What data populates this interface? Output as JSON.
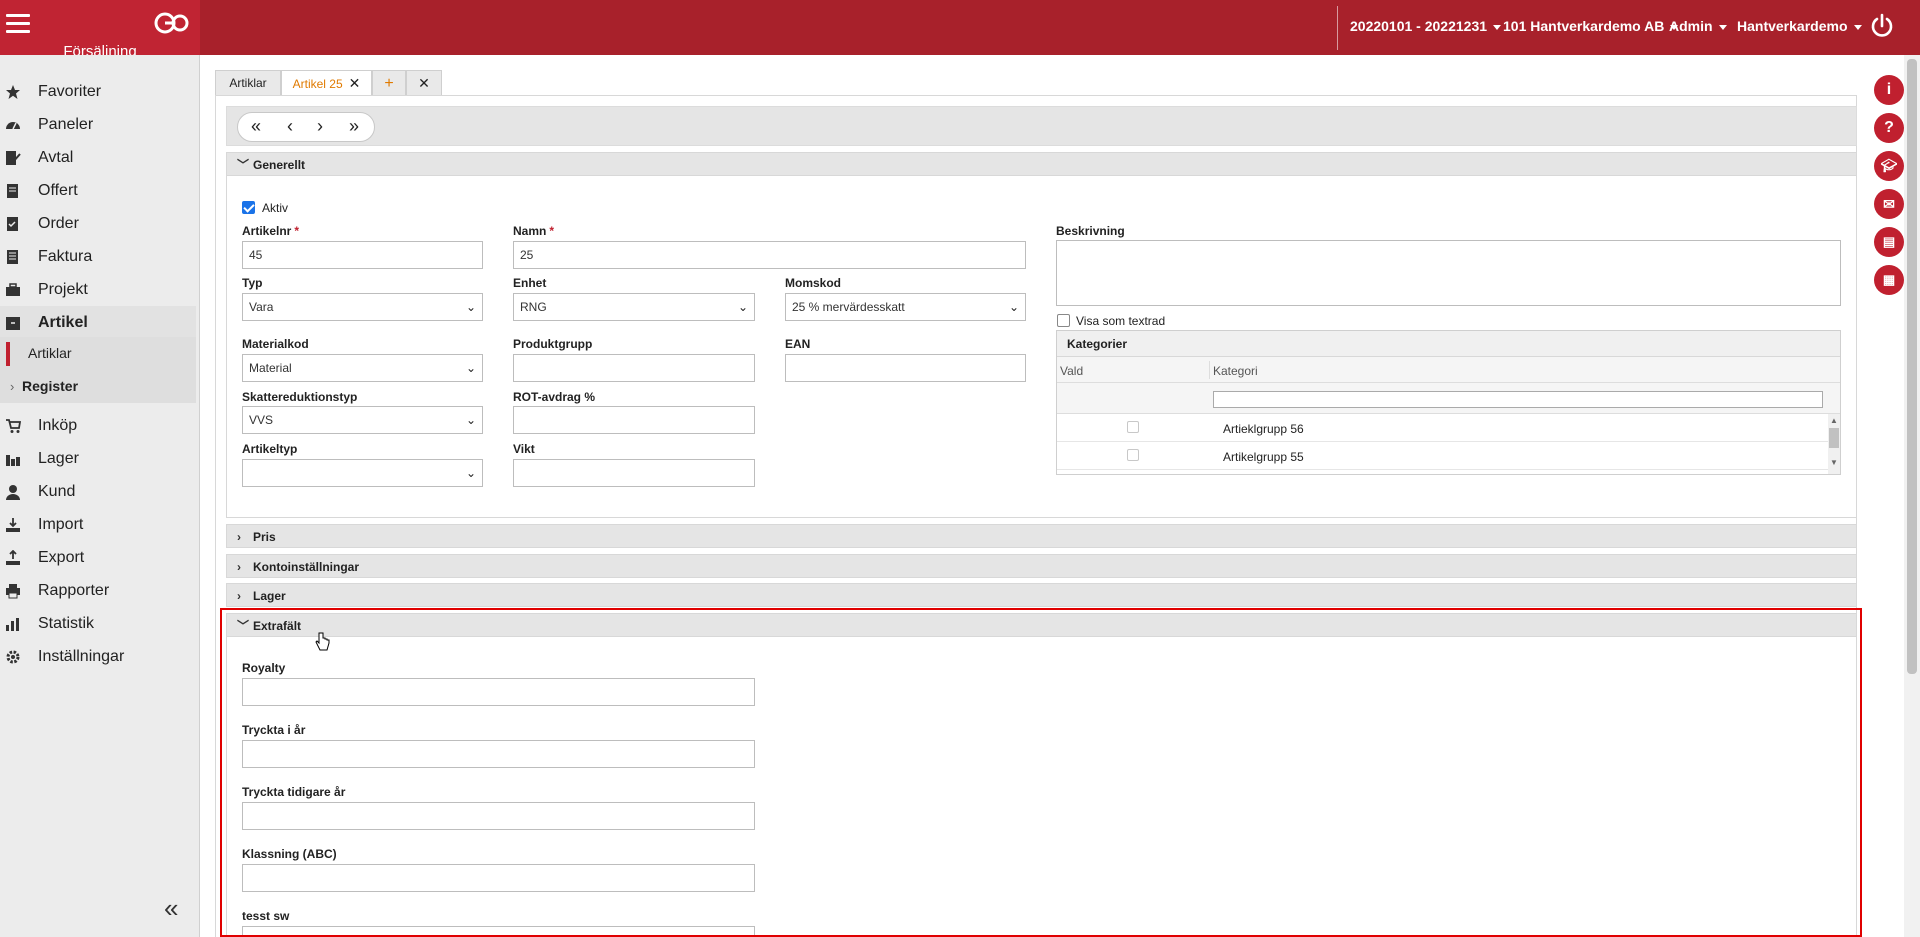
{
  "header": {
    "module_title": "Försäljning",
    "period": "20220101 - 20221231",
    "company": "101 Hantverkardemo AB",
    "role": "Admin",
    "user": "Hantverkardemo"
  },
  "sidebar": {
    "items": [
      {
        "label": "Favoriter",
        "icon": "star-icon"
      },
      {
        "label": "Paneler",
        "icon": "dashboard-icon"
      },
      {
        "label": "Avtal",
        "icon": "contract-icon"
      },
      {
        "label": "Offert",
        "icon": "document-icon"
      },
      {
        "label": "Order",
        "icon": "order-icon"
      },
      {
        "label": "Faktura",
        "icon": "invoice-icon"
      },
      {
        "label": "Projekt",
        "icon": "briefcase-icon"
      },
      {
        "label": "Artikel",
        "icon": "box-icon"
      }
    ],
    "sub_active": "Artiklar",
    "register_label": "Register",
    "items2": [
      {
        "label": "Inköp",
        "icon": "cart-icon"
      },
      {
        "label": "Lager",
        "icon": "warehouse-icon"
      },
      {
        "label": "Kund",
        "icon": "person-icon"
      },
      {
        "label": "Import",
        "icon": "import-icon"
      },
      {
        "label": "Export",
        "icon": "export-icon"
      },
      {
        "label": "Rapporter",
        "icon": "printer-icon"
      },
      {
        "label": "Statistik",
        "icon": "chart-icon"
      },
      {
        "label": "Inställningar",
        "icon": "gear-icon"
      }
    ]
  },
  "tabs": {
    "list_tab": "Artiklar",
    "active_tab": "Artikel 25"
  },
  "sections": {
    "general": "Generellt",
    "price": "Pris",
    "account": "Kontoinställningar",
    "stock": "Lager",
    "extra": "Extrafält"
  },
  "form": {
    "active_label": "Aktiv",
    "active_checked": true,
    "artnr_label": "Artikelnr",
    "artnr_value": "45",
    "name_label": "Namn",
    "name_value": "25",
    "desc_label": "Beskrivning",
    "type_label": "Typ",
    "type_value": "Vara",
    "unit_label": "Enhet",
    "unit_value": "RNG",
    "vat_label": "Momskod",
    "vat_value": "25 % mervärdesskatt",
    "material_label": "Materialkod",
    "material_value": "Material",
    "productgroup_label": "Produktgrupp",
    "ean_label": "EAN",
    "taxred_label": "Skattereduktionstyp",
    "taxred_value": "VVS",
    "rot_label": "ROT-avdrag %",
    "arttype_label": "Artikeltyp",
    "weight_label": "Vikt",
    "show_textrow_label": "Visa som textrad"
  },
  "categories": {
    "title": "Kategorier",
    "col_selected": "Vald",
    "col_category": "Kategori",
    "rows": [
      "Artieklgrupp 56",
      "Artikelgrupp 55"
    ]
  },
  "extra_fields": {
    "royalty": "Royalty",
    "printed_this_year": "Tryckta i år",
    "printed_previous": "Tryckta tidigare år",
    "classification": "Klassning (ABC)",
    "test": "tesst sw"
  },
  "colors": {
    "brand": "#a8212b",
    "accent": "#c0202f",
    "active_tab": "#e07a00",
    "highlight": "#e00000"
  }
}
